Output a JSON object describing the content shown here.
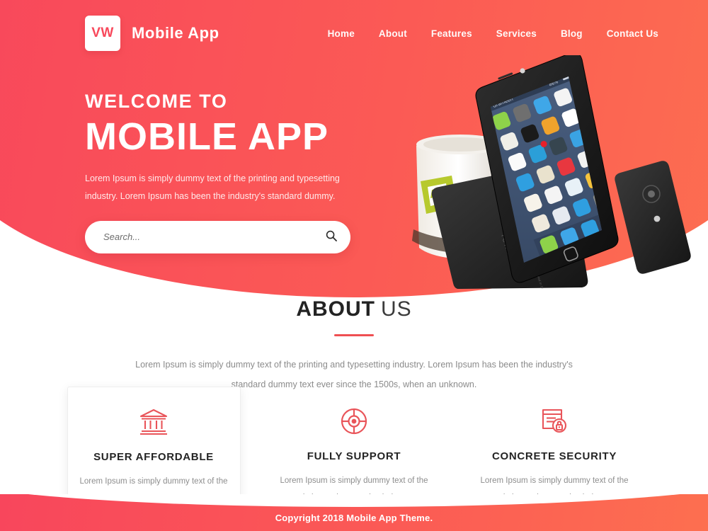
{
  "theme": {
    "gradient_left": "#f8465c",
    "gradient_right": "#fd6f50",
    "accent": "#ef4f52",
    "heading_color": "#232323",
    "body_text_color": "#8b8b8b"
  },
  "header": {
    "logo_mark": "VW",
    "logo_text": "Mobile App",
    "nav": [
      {
        "label": "Home"
      },
      {
        "label": "About"
      },
      {
        "label": "Features"
      },
      {
        "label": "Services"
      },
      {
        "label": "Blog"
      },
      {
        "label": "Contact Us"
      }
    ]
  },
  "hero": {
    "eyebrow": "WELCOME TO",
    "title": "MOBILE APP",
    "paragraph": "Lorem Ipsum is simply dummy text of the printing and typesetting industry. Lorem Ipsum has been the industry's standard dummy.",
    "search_placeholder": "Search...",
    "search_value": "",
    "search_icon": "search-icon",
    "image": {
      "alt": "smartphone-showing-app-home-screen-with-mug",
      "status_bar_carrier": "Grameen"
    }
  },
  "about": {
    "title_bold": "ABOUT",
    "title_light": "US",
    "paragraph": "Lorem Ipsum is simply dummy text of the printing and typesetting industry. Lorem Ipsum has been the industry's standard dummy text ever since the 1500s, when an unknown."
  },
  "features": [
    {
      "icon": "bank-icon",
      "title": "SUPER AFFORDABLE",
      "text": "Lorem Ipsum is simply dummy text of the printing and typesetting industry.",
      "boxed": true
    },
    {
      "icon": "lifebuoy-icon",
      "title": "FULLY SUPPORT",
      "text": "Lorem Ipsum is simply dummy text of the printing and typesetting industry.",
      "boxed": false
    },
    {
      "icon": "document-lock-icon",
      "title": "CONCRETE SECURITY",
      "text": "Lorem Ipsum is simply dummy text of the printing and typesetting industry.",
      "boxed": false
    }
  ],
  "footer": {
    "copyright": "Copyright 2018 Mobile App Theme."
  }
}
